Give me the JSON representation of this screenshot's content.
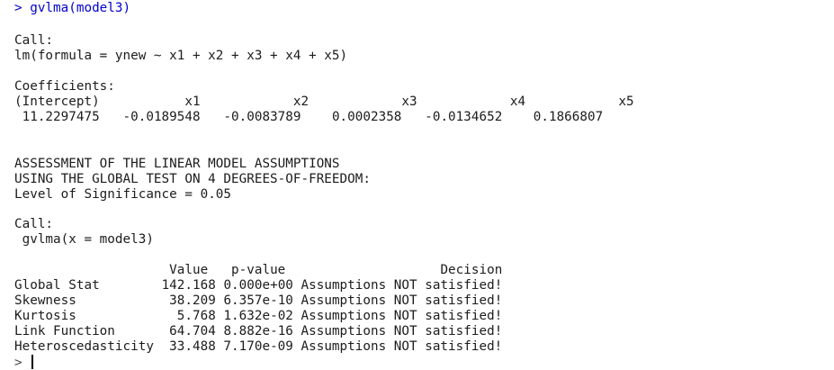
{
  "colors": {
    "command": "#0000cc",
    "output": "#1c1c1c",
    "background": "#ffffff"
  },
  "command_line": {
    "prompt": ">",
    "command": "gvlma(model3)"
  },
  "lm_call": {
    "header": "Call:",
    "formula": "lm(formula = ynew ~ x1 + x2 + x3 + x4 + x5)"
  },
  "coefficients": {
    "header": "Coefficients:",
    "names": [
      "(Intercept)",
      "x1",
      "x2",
      "x3",
      "x4",
      "x5"
    ],
    "values": [
      "11.2297475",
      "-0.0189548",
      "-0.0083789",
      "0.0002358",
      "-0.0134652",
      "0.1866807"
    ]
  },
  "assessment": {
    "line1": "ASSESSMENT OF THE LINEAR MODEL ASSUMPTIONS",
    "line2": "USING THE GLOBAL TEST ON 4 DEGREES-OF-FREEDOM:",
    "significance_label": "Level of Significance = ",
    "significance_value": "0.05"
  },
  "gvlma_call": {
    "header": "Call:",
    "expression": "gvlma(x = model3)"
  },
  "results_table": {
    "headers": [
      "Value",
      "p-value",
      "Decision"
    ],
    "rows": [
      {
        "name": "Global Stat",
        "value": "142.168",
        "p_value": "0.000e+00",
        "decision": "Assumptions NOT satisfied!"
      },
      {
        "name": "Skewness",
        "value": "38.209",
        "p_value": "6.357e-10",
        "decision": "Assumptions NOT satisfied!"
      },
      {
        "name": "Kurtosis",
        "value": "5.768",
        "p_value": "1.632e-02",
        "decision": "Assumptions NOT satisfied!"
      },
      {
        "name": "Link Function",
        "value": "64.704",
        "p_value": "8.882e-16",
        "decision": "Assumptions NOT satisfied!"
      },
      {
        "name": "Heteroscedasticity",
        "value": "33.488",
        "p_value": "7.170e-09",
        "decision": "Assumptions NOT satisfied!"
      }
    ]
  },
  "final_prompt": {
    "prompt": ">"
  }
}
